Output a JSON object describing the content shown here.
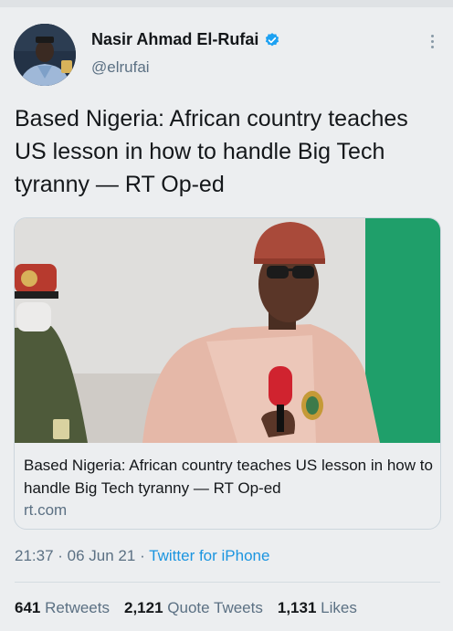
{
  "author": {
    "name": "Nasir Ahmad El-Rufai",
    "handle": "@elrufai",
    "verified_color": "#1da1f2"
  },
  "tweet": {
    "text": "Based Nigeria: African country teaches US lesson in how to handle Big Tech tyranny — RT Op-ed"
  },
  "card": {
    "title": "Based Nigeria: African country teaches US lesson in how to handle Big Tech tyranny — RT Op-ed",
    "domain": "rt.com"
  },
  "meta": {
    "time": "21:37",
    "date": "06 Jun 21",
    "source": "Twitter for iPhone",
    "link_color": "#1b95e0"
  },
  "stats": {
    "retweets_count": "641",
    "retweets_label": "Retweets",
    "quotes_count": "2,121",
    "quotes_label": "Quote Tweets",
    "likes_count": "1,131",
    "likes_label": "Likes"
  }
}
